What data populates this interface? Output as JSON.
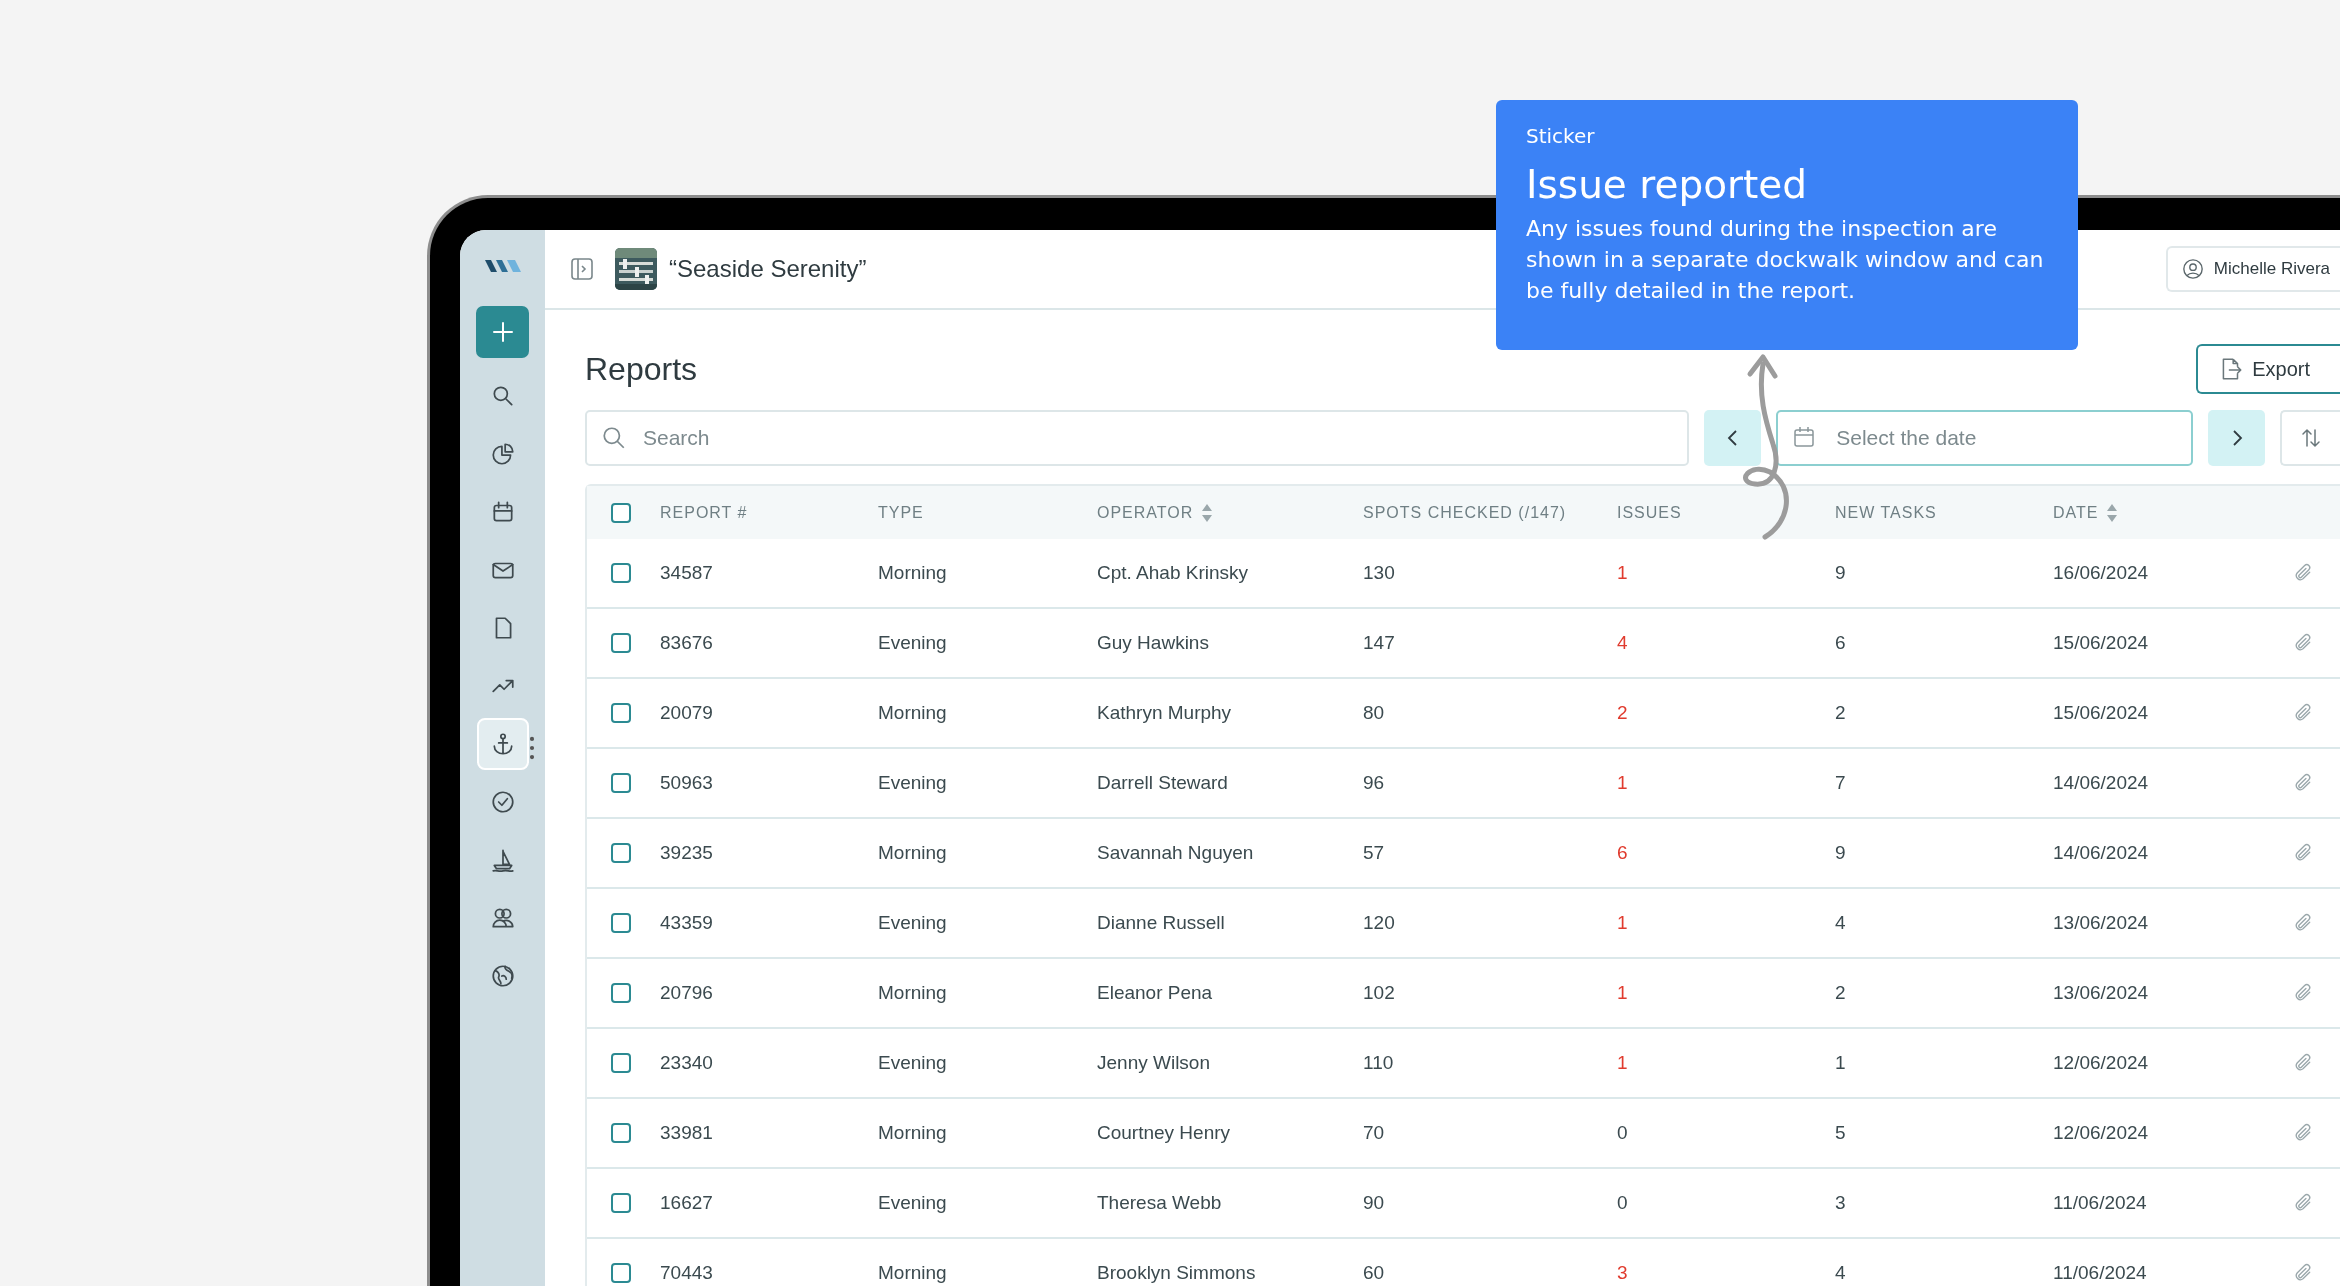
{
  "app": {
    "title": "“Seaside Serenity”",
    "user": "Michelle Rivera"
  },
  "sidebar": {
    "items": [
      {
        "selected": false
      },
      {
        "selected": false
      },
      {
        "selected": false
      },
      {
        "selected": false
      },
      {
        "selected": false
      },
      {
        "selected": false
      },
      {
        "selected": true
      },
      {
        "selected": false
      },
      {
        "selected": false
      },
      {
        "selected": false
      },
      {
        "selected": false
      }
    ]
  },
  "page": {
    "title": "Reports",
    "export": "Export",
    "search": {
      "placeholder": "Search"
    },
    "date": {
      "placeholder": "Select the date"
    }
  },
  "table": {
    "all_checked": false,
    "columns": [
      {
        "label": "REPORT #",
        "sortable": false
      },
      {
        "label": "TYPE",
        "sortable": false
      },
      {
        "label": "OPERATOR",
        "sortable": true
      },
      {
        "label": "SPOTS CHECKED (/147)",
        "sortable": false
      },
      {
        "label": "ISSUES",
        "sortable": false
      },
      {
        "label": "NEW TASKS",
        "sortable": false
      },
      {
        "label": "DATE",
        "sortable": true
      }
    ],
    "rows": [
      {
        "cells": [
          "34587",
          "Morning",
          "Cpt. Ahab Krinsky",
          "130",
          "1",
          "9",
          "16/06/2024"
        ],
        "issues_alert": true,
        "checked": false
      },
      {
        "cells": [
          "83676",
          "Evening",
          "Guy Hawkins",
          "147",
          "4",
          "6",
          "15/06/2024"
        ],
        "issues_alert": true,
        "checked": false
      },
      {
        "cells": [
          "20079",
          "Morning",
          "Kathryn Murphy",
          "80",
          "2",
          "2",
          "15/06/2024"
        ],
        "issues_alert": true,
        "checked": false
      },
      {
        "cells": [
          "50963",
          "Evening",
          "Darrell Steward",
          "96",
          "1",
          "7",
          "14/06/2024"
        ],
        "issues_alert": true,
        "checked": false
      },
      {
        "cells": [
          "39235",
          "Morning",
          "Savannah Nguyen",
          "57",
          "6",
          "9",
          "14/06/2024"
        ],
        "issues_alert": true,
        "checked": false
      },
      {
        "cells": [
          "43359",
          "Evening",
          "Dianne Russell",
          "120",
          "1",
          "4",
          "13/06/2024"
        ],
        "issues_alert": true,
        "checked": false
      },
      {
        "cells": [
          "20796",
          "Morning",
          "Eleanor Pena",
          "102",
          "1",
          "2",
          "13/06/2024"
        ],
        "issues_alert": true,
        "checked": false
      },
      {
        "cells": [
          "23340",
          "Evening",
          "Jenny Wilson",
          "110",
          "1",
          "1",
          "12/06/2024"
        ],
        "issues_alert": true,
        "checked": false
      },
      {
        "cells": [
          "33981",
          "Morning",
          "Courtney Henry",
          "70",
          "0",
          "5",
          "12/06/2024"
        ],
        "issues_alert": false,
        "checked": false
      },
      {
        "cells": [
          "16627",
          "Evening",
          "Theresa Webb",
          "90",
          "0",
          "3",
          "11/06/2024"
        ],
        "issues_alert": false,
        "checked": false
      },
      {
        "cells": [
          "70443",
          "Morning",
          "Brooklyn Simmons",
          "60",
          "3",
          "4",
          "11/06/2024"
        ],
        "issues_alert": true,
        "checked": false
      }
    ]
  },
  "sticker": {
    "label": "Sticker",
    "title": "Issue reported",
    "body": "Any issues found during the inspection are shown in a separate dockwalk window and can be fully detailed in the report."
  }
}
